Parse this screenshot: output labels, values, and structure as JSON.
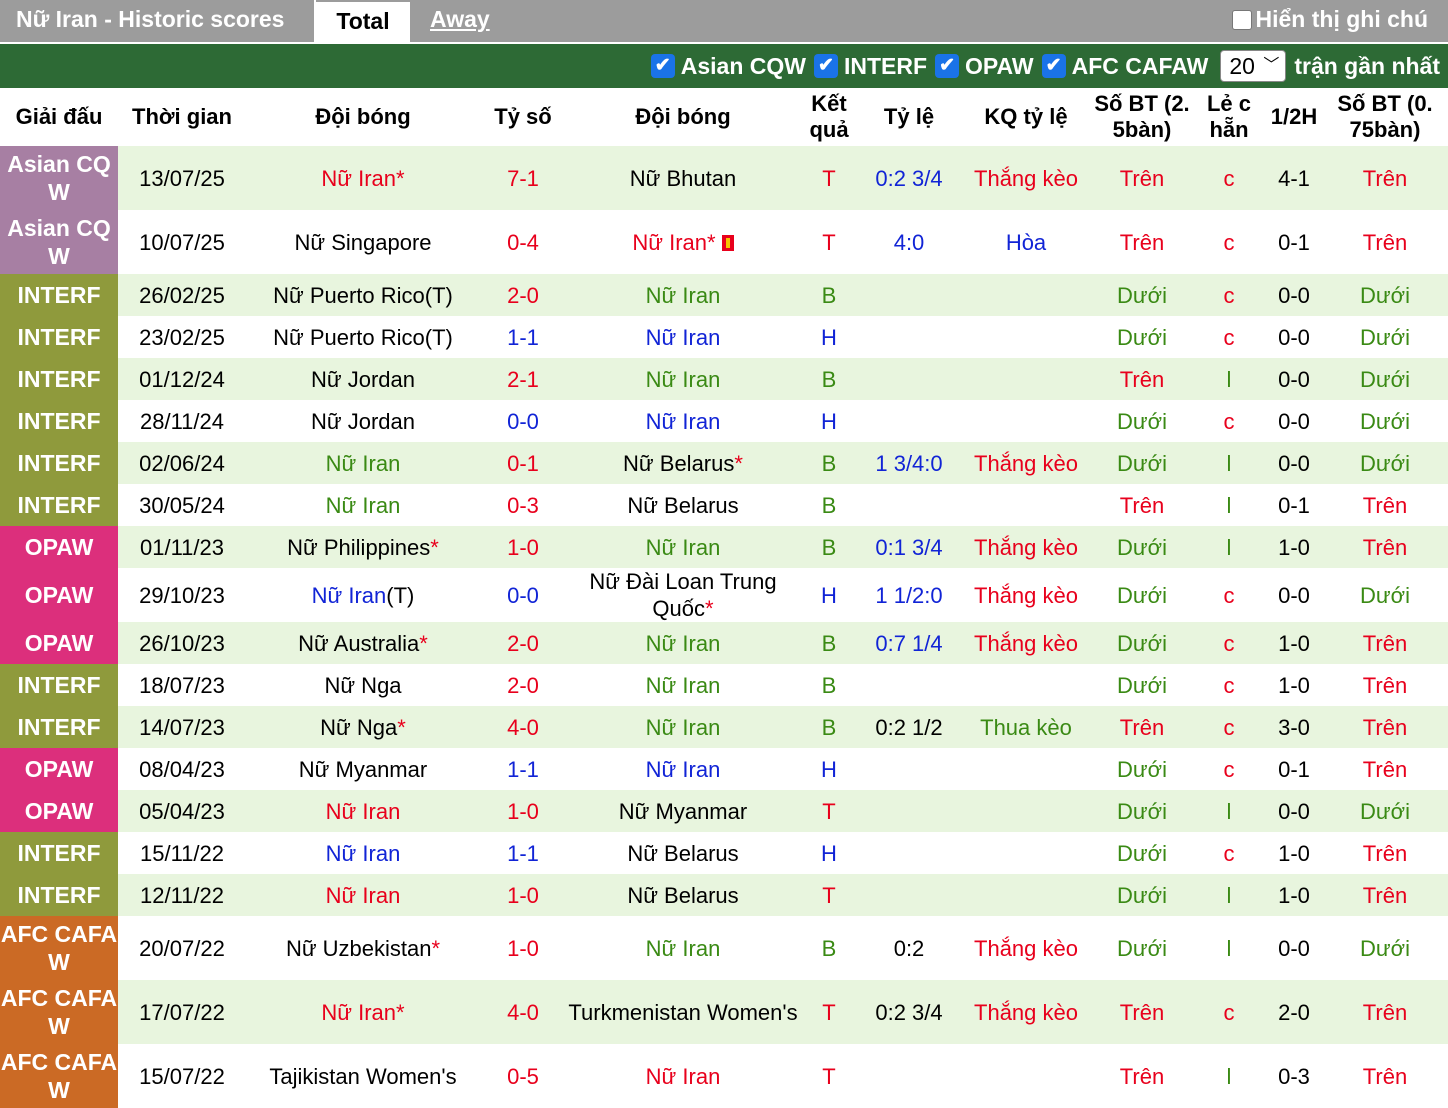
{
  "header": {
    "title": "Nữ Iran - Historic scores",
    "tab_total": "Total",
    "tab_away": "Away",
    "show_notes": "Hiển thị ghi chú"
  },
  "filters": {
    "items": [
      "Asian CQW",
      "INTERF",
      "OPAW",
      "AFC CAFAW"
    ],
    "count_value": "20",
    "count_label": "trận gần nhất"
  },
  "colors": {
    "Asian CQ W": "#a77fa3",
    "INTERF": "#8f9a3c",
    "OPAW": "#dc2f7c",
    "AFC CAFA W": "#cb6a25",
    "header_green": "#2d6a35",
    "row_alt": "#e8f5de"
  },
  "columns": [
    "Giải đấu",
    "Thời gian",
    "Đội bóng",
    "Tỷ số",
    "Đội bóng",
    "Kết quả",
    "Tỷ lệ",
    "KQ tỷ lệ",
    "Số BT (2. 5bàn)",
    "Lẻ c hẵn",
    "1/2H",
    "Số BT (0. 75bàn)"
  ],
  "rows": [
    {
      "league": "Asian CQ W",
      "date": "13/07/25",
      "home": "Nữ Iran*",
      "hc": "red",
      "score": "7-1",
      "sc": "red",
      "away": "Nữ Bhutan",
      "ac": "blk",
      "res": "T",
      "rc": "red",
      "odds": "0:2 3/4",
      "oc": "blue",
      "ores": "Thắng kèo",
      "orc": "red",
      "bt25": "Trên",
      "b1c": "red",
      "oe": "c",
      "oec": "red",
      "half": "4-1",
      "bt075": "Trên",
      "b2c": "red"
    },
    {
      "league": "Asian CQ W",
      "date": "10/07/25",
      "home": "Nữ Singapore",
      "hc": "blk",
      "score": "0-4",
      "sc": "red",
      "away": "Nữ Iran*",
      "ac": "red",
      "card": true,
      "res": "T",
      "rc": "red",
      "odds": "4:0",
      "oc": "blue",
      "ores": "Hòa",
      "orc": "blue",
      "bt25": "Trên",
      "b1c": "red",
      "oe": "c",
      "oec": "red",
      "half": "0-1",
      "bt075": "Trên",
      "b2c": "red"
    },
    {
      "league": "INTERF",
      "date": "26/02/25",
      "home": "Nữ Puerto Rico(T)",
      "hc": "blk",
      "score": "2-0",
      "sc": "red",
      "away": "Nữ Iran",
      "ac": "green",
      "res": "B",
      "rc": "green",
      "odds": "",
      "oc": "blue",
      "ores": "",
      "orc": "red",
      "bt25": "Dưới",
      "b1c": "green",
      "oe": "c",
      "oec": "red",
      "half": "0-0",
      "bt075": "Dưới",
      "b2c": "green"
    },
    {
      "league": "INTERF",
      "date": "23/02/25",
      "home": "Nữ Puerto Rico(T)",
      "hc": "blk",
      "score": "1-1",
      "sc": "blue",
      "away": "Nữ Iran",
      "ac": "blue",
      "res": "H",
      "rc": "blue",
      "odds": "",
      "oc": "blue",
      "ores": "",
      "orc": "red",
      "bt25": "Dưới",
      "b1c": "green",
      "oe": "c",
      "oec": "red",
      "half": "0-0",
      "bt075": "Dưới",
      "b2c": "green"
    },
    {
      "league": "INTERF",
      "date": "01/12/24",
      "home": "Nữ Jordan",
      "hc": "blk",
      "score": "2-1",
      "sc": "red",
      "away": "Nữ Iran",
      "ac": "green",
      "res": "B",
      "rc": "green",
      "odds": "",
      "oc": "blue",
      "ores": "",
      "orc": "red",
      "bt25": "Trên",
      "b1c": "red",
      "oe": "l",
      "oec": "green",
      "half": "0-0",
      "bt075": "Dưới",
      "b2c": "green"
    },
    {
      "league": "INTERF",
      "date": "28/11/24",
      "home": "Nữ Jordan",
      "hc": "blk",
      "score": "0-0",
      "sc": "blue",
      "away": "Nữ Iran",
      "ac": "blue",
      "res": "H",
      "rc": "blue",
      "odds": "",
      "oc": "blue",
      "ores": "",
      "orc": "red",
      "bt25": "Dưới",
      "b1c": "green",
      "oe": "c",
      "oec": "red",
      "half": "0-0",
      "bt075": "Dưới",
      "b2c": "green"
    },
    {
      "league": "INTERF",
      "date": "02/06/24",
      "home": "Nữ Iran",
      "hc": "green",
      "score": "0-1",
      "sc": "red",
      "away": "Nữ Belarus*",
      "ac": "blk",
      "astar": true,
      "res": "B",
      "rc": "green",
      "odds": "1 3/4:0",
      "oc": "blue",
      "ores": "Thắng kèo",
      "orc": "red",
      "bt25": "Dưới",
      "b1c": "green",
      "oe": "l",
      "oec": "green",
      "half": "0-0",
      "bt075": "Dưới",
      "b2c": "green"
    },
    {
      "league": "INTERF",
      "date": "30/05/24",
      "home": "Nữ Iran",
      "hc": "green",
      "score": "0-3",
      "sc": "red",
      "away": "Nữ Belarus",
      "ac": "blk",
      "res": "B",
      "rc": "green",
      "odds": "",
      "oc": "blue",
      "ores": "",
      "orc": "red",
      "bt25": "Trên",
      "b1c": "red",
      "oe": "l",
      "oec": "green",
      "half": "0-1",
      "bt075": "Trên",
      "b2c": "red"
    },
    {
      "league": "OPAW",
      "date": "01/11/23",
      "home": "Nữ Philippines*",
      "hc": "blk",
      "hstar": true,
      "score": "1-0",
      "sc": "red",
      "away": "Nữ Iran",
      "ac": "green",
      "res": "B",
      "rc": "green",
      "odds": "0:1 3/4",
      "oc": "blue",
      "ores": "Thắng kèo",
      "orc": "red",
      "bt25": "Dưới",
      "b1c": "green",
      "oe": "l",
      "oec": "green",
      "half": "1-0",
      "bt075": "Trên",
      "b2c": "red"
    },
    {
      "league": "OPAW",
      "date": "29/10/23",
      "home": "Nữ Iran(T)",
      "hc": "blue",
      "htail": "(T)",
      "score": "0-0",
      "sc": "blue",
      "away": "Nữ Đài Loan Trung Quốc*",
      "ac": "blk",
      "astar": true,
      "res": "H",
      "rc": "blue",
      "odds": "1 1/2:0",
      "oc": "blue",
      "ores": "Thắng kèo",
      "orc": "red",
      "bt25": "Dưới",
      "b1c": "green",
      "oe": "c",
      "oec": "red",
      "half": "0-0",
      "bt075": "Dưới",
      "b2c": "green"
    },
    {
      "league": "OPAW",
      "date": "26/10/23",
      "home": "Nữ Australia*",
      "hc": "blk",
      "hstar": true,
      "score": "2-0",
      "sc": "red",
      "away": "Nữ Iran",
      "ac": "green",
      "res": "B",
      "rc": "green",
      "odds": "0:7 1/4",
      "oc": "blue",
      "ores": "Thắng kèo",
      "orc": "red",
      "bt25": "Dưới",
      "b1c": "green",
      "oe": "c",
      "oec": "red",
      "half": "1-0",
      "bt075": "Trên",
      "b2c": "red"
    },
    {
      "league": "INTERF",
      "date": "18/07/23",
      "home": "Nữ Nga",
      "hc": "blk",
      "score": "2-0",
      "sc": "red",
      "away": "Nữ Iran",
      "ac": "green",
      "res": "B",
      "rc": "green",
      "odds": "",
      "oc": "blue",
      "ores": "",
      "orc": "red",
      "bt25": "Dưới",
      "b1c": "green",
      "oe": "c",
      "oec": "red",
      "half": "1-0",
      "bt075": "Trên",
      "b2c": "red"
    },
    {
      "league": "INTERF",
      "date": "14/07/23",
      "home": "Nữ Nga*",
      "hc": "blk",
      "hstar": true,
      "score": "4-0",
      "sc": "red",
      "away": "Nữ Iran",
      "ac": "green",
      "res": "B",
      "rc": "green",
      "odds": "0:2 1/2",
      "oc": "blk",
      "ores": "Thua kèo",
      "orc": "green",
      "bt25": "Trên",
      "b1c": "red",
      "oe": "c",
      "oec": "red",
      "half": "3-0",
      "bt075": "Trên",
      "b2c": "red"
    },
    {
      "league": "OPAW",
      "date": "08/04/23",
      "home": "Nữ Myanmar",
      "hc": "blk",
      "score": "1-1",
      "sc": "blue",
      "away": "Nữ Iran",
      "ac": "blue",
      "res": "H",
      "rc": "blue",
      "odds": "",
      "oc": "blue",
      "ores": "",
      "orc": "red",
      "bt25": "Dưới",
      "b1c": "green",
      "oe": "c",
      "oec": "red",
      "half": "0-1",
      "bt075": "Trên",
      "b2c": "red"
    },
    {
      "league": "OPAW",
      "date": "05/04/23",
      "home": "Nữ Iran",
      "hc": "red",
      "score": "1-0",
      "sc": "red",
      "away": "Nữ Myanmar",
      "ac": "blk",
      "res": "T",
      "rc": "red",
      "odds": "",
      "oc": "blue",
      "ores": "",
      "orc": "red",
      "bt25": "Dưới",
      "b1c": "green",
      "oe": "l",
      "oec": "green",
      "half": "0-0",
      "bt075": "Dưới",
      "b2c": "green"
    },
    {
      "league": "INTERF",
      "date": "15/11/22",
      "home": "Nữ Iran",
      "hc": "blue",
      "score": "1-1",
      "sc": "blue",
      "away": "Nữ Belarus",
      "ac": "blk",
      "res": "H",
      "rc": "blue",
      "odds": "",
      "oc": "blue",
      "ores": "",
      "orc": "red",
      "bt25": "Dưới",
      "b1c": "green",
      "oe": "c",
      "oec": "red",
      "half": "1-0",
      "bt075": "Trên",
      "b2c": "red"
    },
    {
      "league": "INTERF",
      "date": "12/11/22",
      "home": "Nữ Iran",
      "hc": "red",
      "score": "1-0",
      "sc": "red",
      "away": "Nữ Belarus",
      "ac": "blk",
      "res": "T",
      "rc": "red",
      "odds": "",
      "oc": "blue",
      "ores": "",
      "orc": "red",
      "bt25": "Dưới",
      "b1c": "green",
      "oe": "l",
      "oec": "green",
      "half": "1-0",
      "bt075": "Trên",
      "b2c": "red"
    },
    {
      "league": "AFC CAFA W",
      "date": "20/07/22",
      "home": "Nữ Uzbekistan*",
      "hc": "blk",
      "hstar": true,
      "score": "1-0",
      "sc": "red",
      "away": "Nữ Iran",
      "ac": "green",
      "res": "B",
      "rc": "green",
      "odds": "0:2",
      "oc": "blk",
      "ores": "Thắng kèo",
      "orc": "red",
      "bt25": "Dưới",
      "b1c": "green",
      "oe": "l",
      "oec": "green",
      "half": "0-0",
      "bt075": "Dưới",
      "b2c": "green"
    },
    {
      "league": "AFC CAFA W",
      "date": "17/07/22",
      "home": "Nữ Iran*",
      "hc": "red",
      "score": "4-0",
      "sc": "red",
      "away": "Turkmenistan Women's",
      "ac": "blk",
      "res": "T",
      "rc": "red",
      "odds": "0:2 3/4",
      "oc": "blk",
      "ores": "Thắng kèo",
      "orc": "red",
      "bt25": "Trên",
      "b1c": "red",
      "oe": "c",
      "oec": "red",
      "half": "2-0",
      "bt075": "Trên",
      "b2c": "red"
    },
    {
      "league": "AFC CAFA W",
      "date": "15/07/22",
      "home": "Tajikistan Women's",
      "hc": "blk",
      "score": "0-5",
      "sc": "red",
      "away": "Nữ Iran",
      "ac": "red",
      "res": "T",
      "rc": "red",
      "odds": "",
      "oc": "blue",
      "ores": "",
      "orc": "red",
      "bt25": "Trên",
      "b1c": "red",
      "oe": "l",
      "oec": "green",
      "half": "0-3",
      "bt075": "Trên",
      "b2c": "red"
    }
  ]
}
